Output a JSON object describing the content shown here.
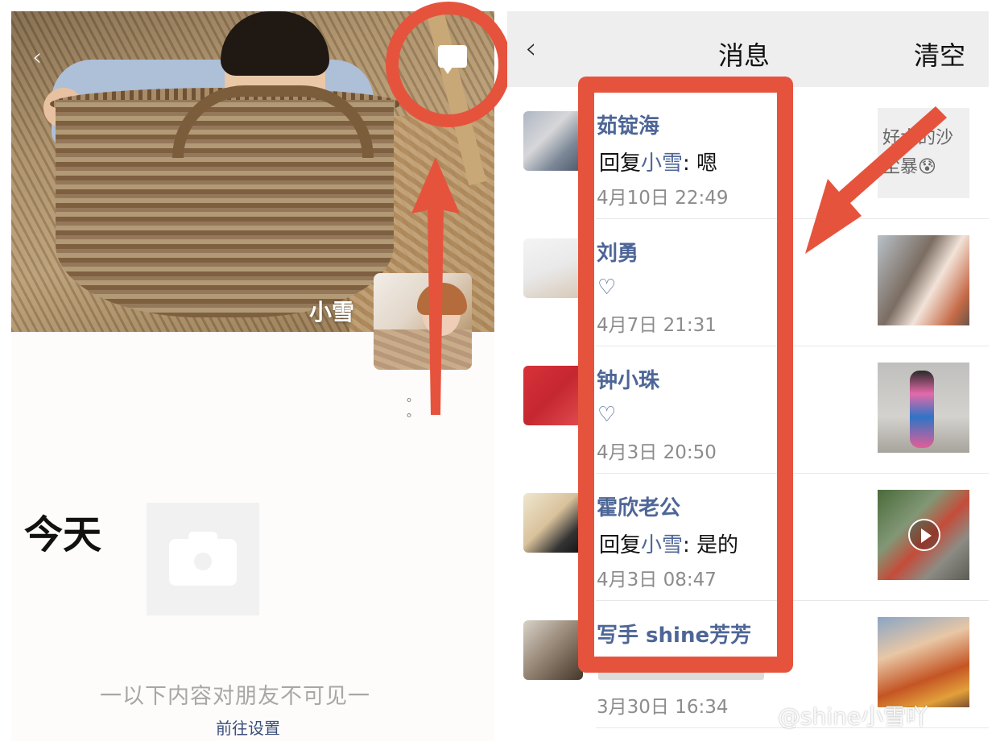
{
  "left": {
    "nickname": "小雪",
    "back_glyph": "‹",
    "today_label": "今天",
    "privacy_note": "一以下内容对朋友不可见一",
    "settings_link": "前往设置",
    "page_dots": "° °"
  },
  "header": {
    "back_glyph": "‹",
    "title": "消息",
    "clear_label": "清空"
  },
  "messages": [
    {
      "name": "茹锭海",
      "type": "reply",
      "reply_prefix": "回复",
      "reply_to": "小雪",
      "reply_text": ": 嗯",
      "time": "4月10日 22:49",
      "thumb_text": "好大的沙尘暴😰"
    },
    {
      "name": "刘勇",
      "type": "like",
      "like_glyph": "♡",
      "time": "4月7日 21:31"
    },
    {
      "name": "钟小珠",
      "type": "like",
      "like_glyph": "♡",
      "time": "4月3日 20:50"
    },
    {
      "name": "霍欣老公",
      "type": "reply",
      "reply_prefix": "回复",
      "reply_to": "小雪",
      "reply_text": ": 是的",
      "time": "4月3日 08:47"
    },
    {
      "name": "写手  shine芳芳",
      "type": "hidden",
      "time": "3月30日 16:34"
    }
  ],
  "watermark": "@shine小雪吖",
  "colors": {
    "annotation_red": "#e6533d",
    "link_blue": "#4e6697",
    "time_gray": "#8c8c8c"
  },
  "icons": {
    "message": "speech-bubble-icon",
    "camera": "camera-icon",
    "video": "play-icon",
    "like": "heart-outline-icon"
  }
}
